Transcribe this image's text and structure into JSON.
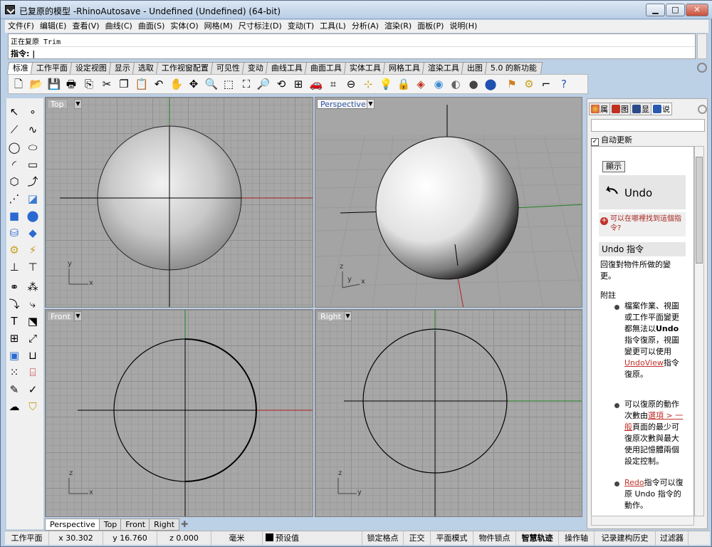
{
  "window": {
    "title": "已复原的模型 -RhinoAutosave - Undefined (Undefined) (64-bit)",
    "min_icon": "minimize-icon",
    "max_icon": "maximize-icon",
    "close_icon": "close-icon"
  },
  "menu": [
    "文件(F)",
    "编辑(E)",
    "查看(V)",
    "曲线(C)",
    "曲面(S)",
    "实体(O)",
    "网格(M)",
    "尺寸标注(D)",
    "变动(T)",
    "工具(L)",
    "分析(A)",
    "渲染(R)",
    "面板(P)",
    "说明(H)"
  ],
  "command": {
    "history": "正在复原 Trim",
    "prompt": "指令: |"
  },
  "toolbar_tabs": [
    "标准",
    "工作平面",
    "设定视图",
    "显示",
    "选取",
    "工作视窗配置",
    "可见性",
    "变动",
    "曲线工具",
    "曲面工具",
    "实体工具",
    "网格工具",
    "渲染工具",
    "出图",
    "5.0 的新功能"
  ],
  "toolbar_icons": [
    "new-icon",
    "open-icon",
    "save-icon",
    "print-icon",
    "import-icon",
    "cut-icon",
    "copy-icon",
    "paste-icon",
    "undo-icon",
    "pan-icon",
    "rotate-view-icon",
    "zoom-icon",
    "zoom-window-icon",
    "zoom-extents-icon",
    "zoom-selected-icon",
    "rotate-icon",
    "four-viewports-icon",
    "car-icon",
    "named-views-icon",
    "cplane-icon",
    "snap-icon",
    "light-icon",
    "lock-icon",
    "material-icon",
    "color-wheel-icon",
    "shaded-icon",
    "rendered-icon",
    "render-icon",
    "options-icon",
    "tools-icon",
    "grid-snap-icon",
    "help-icon"
  ],
  "left_tool_icons": [
    "select-icon",
    "point-icon",
    "polyline-icon",
    "curve-icon",
    "circle-icon",
    "ellipse-icon",
    "arc-icon",
    "rectangle-icon",
    "polygon-icon",
    "freeform-icon",
    "surface-points-icon",
    "surface-edit-icon",
    "box-icon",
    "sphere-icon",
    "cylinder-icon",
    "mesh-icon",
    "gear-tools-icon",
    "lightning-icon",
    "extrude-icon",
    "project-icon",
    "boolean-icon",
    "split-icon",
    "fillet-icon",
    "blend-icon",
    "move-icon",
    "scale-icon",
    "array-icon",
    "bend-icon",
    "solid-box-icon",
    "dimension-icon",
    "grid-array-icon",
    "align-icon",
    "text-icon",
    "check-icon",
    "cloud-icon",
    "paint-bucket-icon"
  ],
  "viewports": {
    "top": {
      "label": "Top",
      "axis_x": "x",
      "axis_y": "y"
    },
    "perspective": {
      "label": "Perspective",
      "axis_x": "x",
      "axis_y": "y",
      "axis_z": "z"
    },
    "front": {
      "label": "Front",
      "axis_x": "x",
      "axis_y": "z"
    },
    "right": {
      "label": "Right",
      "axis_x": "y",
      "axis_y": "z"
    }
  },
  "viewport_tabs": [
    "Perspective",
    "Top",
    "Front",
    "Right"
  ],
  "panel": {
    "tabs": [
      "属",
      "图",
      "显",
      "说"
    ],
    "tab_colors": [
      "#d04030",
      "#c03020",
      "#2a4a8a",
      "#2a5ab0"
    ],
    "auto_update": "自动更新",
    "show_button": "顯示",
    "undo_title": "Undo",
    "where_text": "可以在哪裡找到這個指令?",
    "command_title": "Undo 指令",
    "command_desc": "回復對物件所做的變更。",
    "notes_title": "附註",
    "note1_a": "檔案作業、視圖或工作平面變更都無法以",
    "note1_b": "Undo",
    "note1_c": "指令復原，視圖變更可以使用",
    "note1_link": "UndoView",
    "note1_d": "指令復原。",
    "note2_a": "可以復原的動作次數由",
    "note2_link": "選項 > 一般",
    "note2_b": "頁面的最少可復原次數與最大使用記憶體兩個設定控制。",
    "note3_link": "Redo",
    "note3_a": "指令可以復原 Undo 指令的動作。"
  },
  "status": {
    "cplane": "工作平面",
    "x": "x 30.302",
    "y": "y 16.760",
    "z": "z 0.000",
    "units": "毫米",
    "layer": "预设值",
    "osnap": "锁定格点",
    "ortho": "正交",
    "planar": "平面模式",
    "osnap_obj": "物件锁点",
    "smarttrack": "智慧轨迹",
    "gumball": "操作轴",
    "history": "记录建构历史",
    "filter": "过滤器"
  },
  "colors": {
    "viewport_bg": "#a7a7a7",
    "x_axis": "#b02020",
    "y_axis": "#208020",
    "link": "#c0302a"
  }
}
